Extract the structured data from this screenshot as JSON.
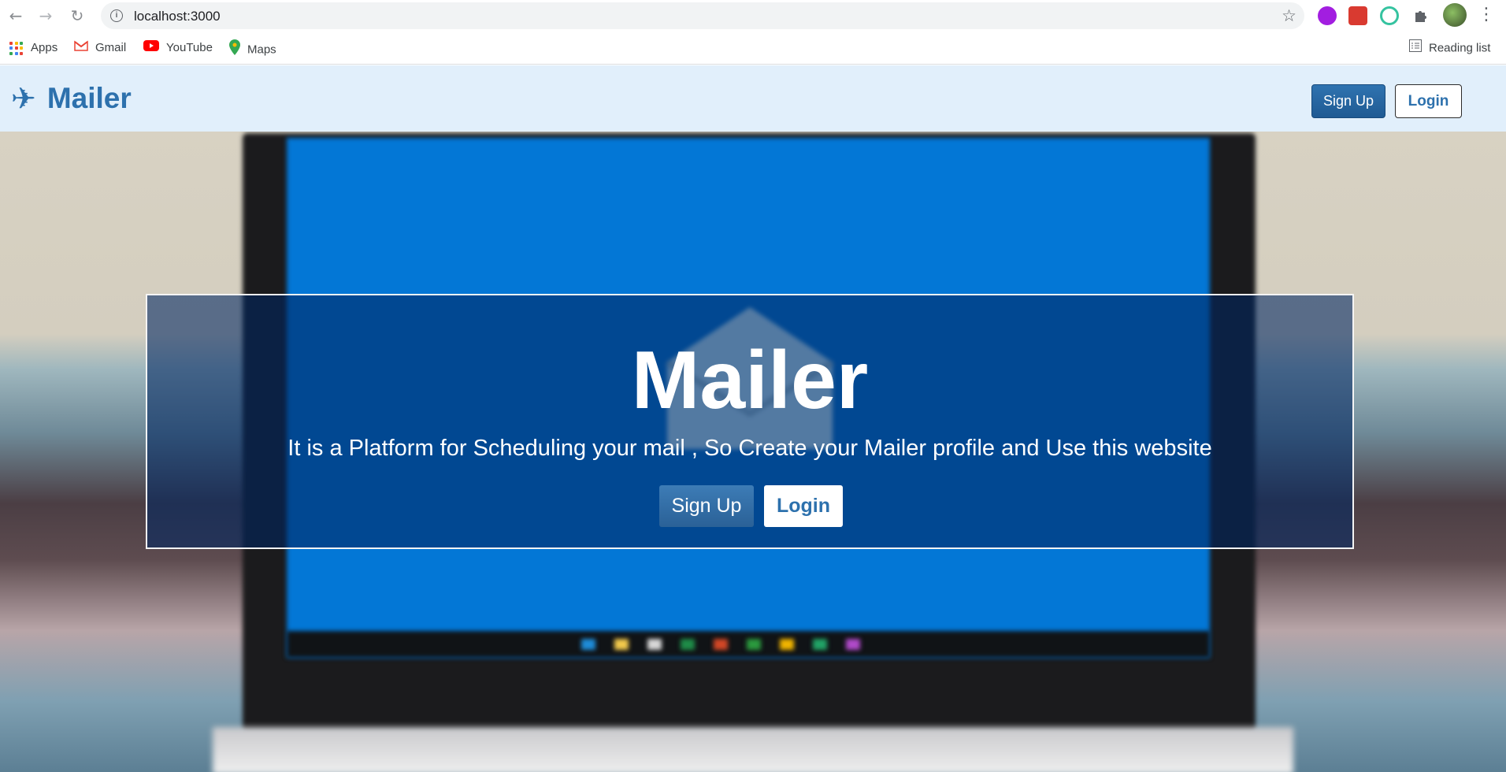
{
  "browser": {
    "url": "localhost:3000",
    "bookmarks": [
      "Apps",
      "Gmail",
      "YouTube",
      "Maps"
    ],
    "reading_list": "Reading list"
  },
  "navbar": {
    "brand": "Mailer",
    "signup_label": "Sign Up",
    "login_label": "Login"
  },
  "hero": {
    "title": "Mailer",
    "subtitle": "It is a Platform for Scheduling your mail , So Create your Mailer profile and Use this website",
    "signup_label": "Sign Up",
    "login_label": "Login"
  },
  "colors": {
    "brand": "#2d71ad",
    "navbar_bg": "#e1effb",
    "hero_overlay": "#00417f"
  },
  "icons": {
    "back": "arrow-left-icon",
    "forward": "arrow-right-icon",
    "reload": "reload-icon",
    "site_info": "info-icon",
    "bookmark_star": "star-icon",
    "extensions": "puzzle-icon",
    "menu": "kebab-menu-icon",
    "brand": "airplane-icon"
  }
}
